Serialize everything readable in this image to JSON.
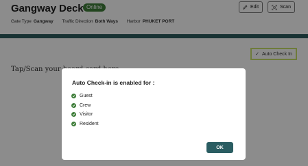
{
  "header": {
    "title": "Gangway Deck 1",
    "status": "Online",
    "gate_type_label": "Gate Type",
    "gate_type_value": "Gangway",
    "traffic_label": "Traffic Direction",
    "traffic_value": "Both Ways",
    "harbor_label": "Harbor",
    "harbor_value": "PHUKET PORT",
    "edit_label": "Edit",
    "scan_label": "Scan"
  },
  "main": {
    "auto_checkin_label": "Auto Check In",
    "tap_scan_text": "Tap/Scan your board card here"
  },
  "modal": {
    "title": "Auto Check-in is enabled for :",
    "items": [
      "Guest",
      "Crew",
      "Visitor",
      "Resident"
    ],
    "ok_label": "OK"
  },
  "colors": {
    "online_badge": "#3f7e3a",
    "teal_bar": "#2c5c5e",
    "auto_checkin_border": "#c8e06a",
    "ok_button": "#2a5d62"
  },
  "icons": {
    "edit": "pencil-icon",
    "scan": "scan-icon",
    "auto_checkin": "check-icon",
    "list_item": "check-circle-icon"
  }
}
